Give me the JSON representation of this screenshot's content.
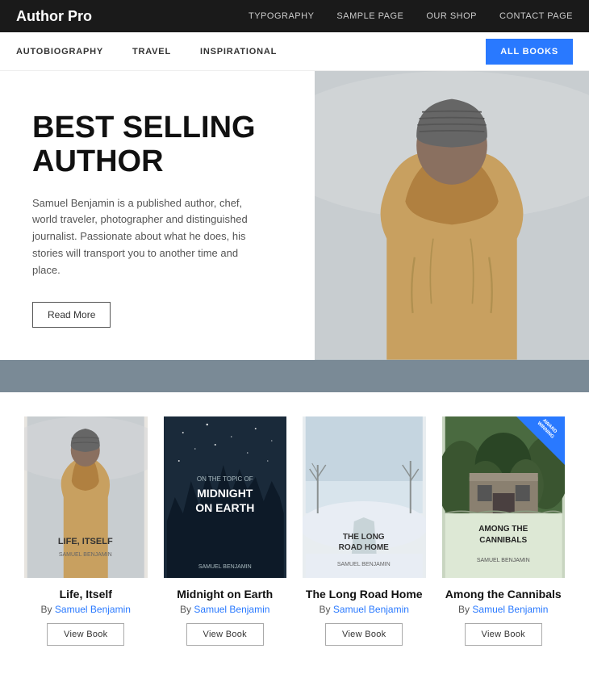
{
  "brand": "Author Pro",
  "topNav": {
    "links": [
      {
        "label": "TYPOGRAPHY",
        "href": "#"
      },
      {
        "label": "SAMPLE PAGE",
        "href": "#"
      },
      {
        "label": "OUR SHOP",
        "href": "#"
      },
      {
        "label": "CONTACT PAGE",
        "href": "#"
      }
    ]
  },
  "subNav": {
    "links": [
      {
        "label": "AUTOBIOGRAPHY"
      },
      {
        "label": "TRAVEL"
      },
      {
        "label": "INSPIRATIONAL"
      }
    ],
    "allBooksLabel": "ALL BOOKS"
  },
  "hero": {
    "heading": "BEST SELLING AUTHOR",
    "description": "Samuel Benjamin is a published author, chef, world traveler, photographer and distinguished journalist. Passionate about what he does, his stories will transport you to another time and place.",
    "readMoreLabel": "Read More"
  },
  "books": [
    {
      "title": "Life, Itself",
      "author": "Samuel Benjamin",
      "authorColor": "#2979ff",
      "viewLabel": "View Book",
      "coverType": "1",
      "coverLines": [
        "LIFE, ITSELF",
        "SAMUEL BENJAMIN"
      ],
      "award": false
    },
    {
      "title": "Midnight on Earth",
      "author": "Samuel Benjamin",
      "authorColor": "#2979ff",
      "viewLabel": "View Book",
      "coverType": "2",
      "coverLines": [
        "ON THE TOPIC OF",
        "MIDNIGHT ON EARTH",
        "SAMUEL BENJAMIN"
      ],
      "award": false
    },
    {
      "title": "The Long Road Home",
      "author": "Samuel Benjamin",
      "authorColor": "#2979ff",
      "viewLabel": "View Book",
      "coverType": "3",
      "coverLines": [
        "THE LONG ROAD HOME",
        "SAMUEL BENJAMIN"
      ],
      "award": false
    },
    {
      "title": "Among the Cannibals",
      "author": "Samuel Benjamin",
      "authorColor": "#2979ff",
      "viewLabel": "View Book",
      "coverType": "4",
      "coverLines": [
        "AMONG THE CANNIBALS",
        "SAMUEL BENJAMIN"
      ],
      "award": true,
      "awardText": "AWARD WINNING"
    }
  ]
}
